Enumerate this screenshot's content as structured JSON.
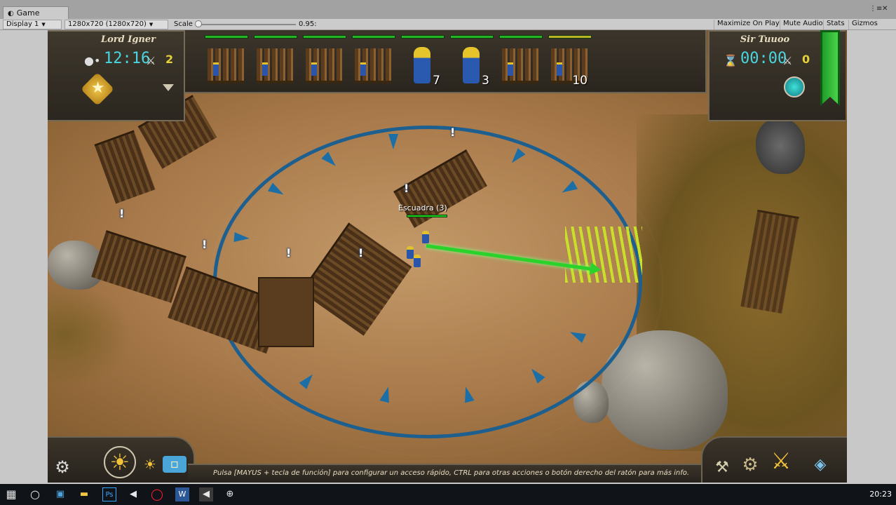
{
  "editor": {
    "tab_title": "Game",
    "display": "Display 1",
    "resolution": "1280x720 (1280x720)",
    "scale_label": "Scale",
    "scale_value": "0.95:",
    "maximize_on_play": "Maximize On Play",
    "mute_audio": "Mute Audio",
    "stats": "Stats",
    "gizmos": "Gizmos"
  },
  "player_left": {
    "name": "Lord Igner",
    "timer": "12:16",
    "kills": "2"
  },
  "player_right": {
    "name": "Sir Tuuoo",
    "timer": "00:00",
    "kills": "0"
  },
  "unit_bar": {
    "slots": [
      {
        "type": "palisade",
        "count": ""
      },
      {
        "type": "palisade",
        "count": ""
      },
      {
        "type": "gate",
        "count": ""
      },
      {
        "type": "palisade",
        "count": ""
      },
      {
        "type": "soldier",
        "count": "7"
      },
      {
        "type": "soldier",
        "count": "3"
      },
      {
        "type": "palisade",
        "count": ""
      },
      {
        "type": "palisade",
        "count": "10"
      }
    ],
    "health_segments": [
      "full",
      "full",
      "full",
      "full",
      "full",
      "full",
      "full",
      "weak"
    ]
  },
  "squad": {
    "label": "Escuadra (3)"
  },
  "hint_text": "Pulsa [MAYUS + tecla de función] para configurar un acceso rápido, CTRL para otras acciones o botón derecho del ratón para más info.",
  "icons": {
    "left_hud": [
      "gear-icon",
      "sun-icon",
      "small-sun-icon",
      "chat-icon"
    ],
    "right_hud": [
      "build-icon",
      "siege-icon",
      "swords-icon",
      "map-icon"
    ]
  },
  "taskbar": {
    "clock": "20:23"
  },
  "colors": {
    "timer": "#49d6e0",
    "kills": "#e7d13b",
    "health": "#23b523",
    "move_arrow": "#2bd22b",
    "compass_ring": "#1d5f8f"
  }
}
